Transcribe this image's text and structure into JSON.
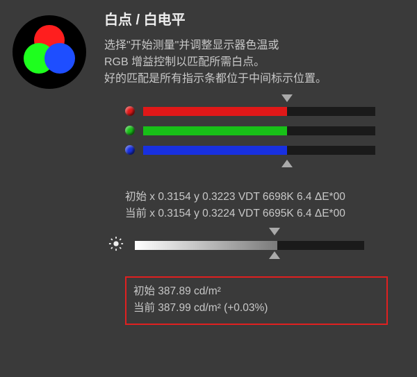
{
  "title": "白点 / 白电平",
  "body": {
    "line1": "选择\"开始测量\"并调整显示器色温或",
    "line2": "RGB 增益控制以匹配所需白点。",
    "line3": "好的匹配是所有指示条都位于中间标示位置。"
  },
  "colors": {
    "red": "#e01818",
    "green": "#18c018",
    "blue": "#1830e0",
    "bar_bg": "#1a1a1a"
  },
  "bars": {
    "center_pct": 62,
    "red_fill_pct": 62,
    "green_fill_pct": 62,
    "blue_fill_pct": 62
  },
  "readout": {
    "initial": "初始 x 0.3154 y 0.3223 VDT 6698K 6.4 ΔE*00",
    "current": "当前 x 0.3154 y 0.3224 VDT 6695K 6.4 ΔE*00"
  },
  "brightness": {
    "center_pct": 62,
    "fill_pct": 62
  },
  "readout2": {
    "initial": "初始 387.89 cd/m²",
    "current": "当前 387.99 cd/m² (+0.03%)"
  }
}
